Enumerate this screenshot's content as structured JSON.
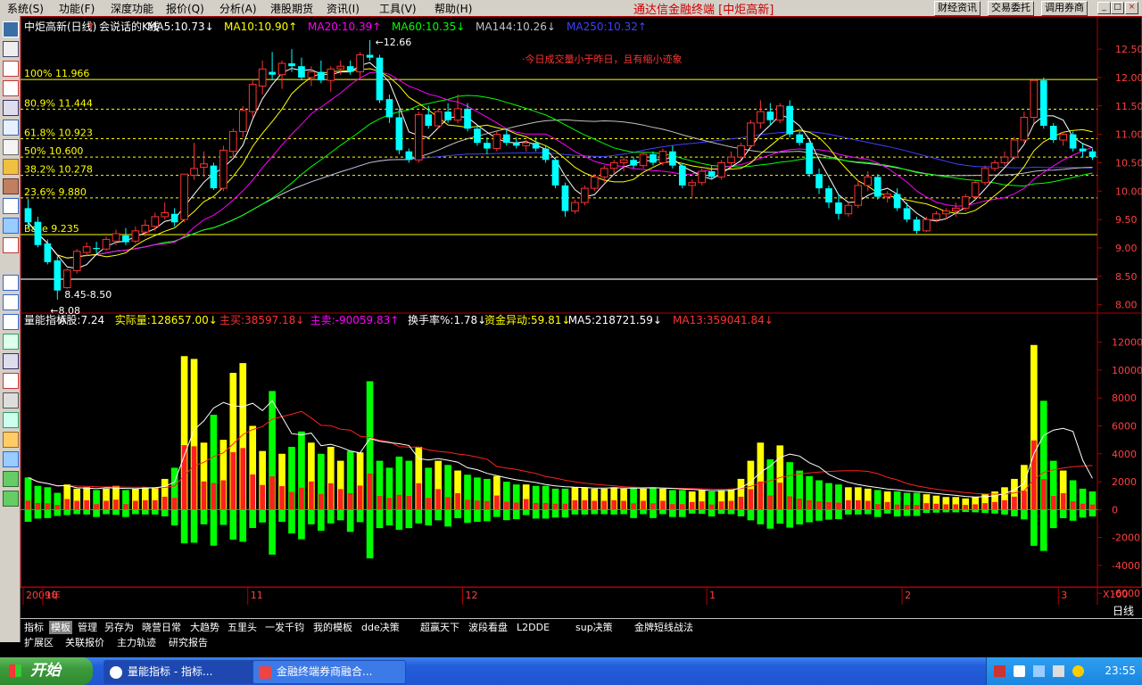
{
  "menu": [
    "系统(S)",
    "功能(F)",
    "深度功能",
    "报价(Q)",
    "分析(A)",
    "港股期货",
    "资讯(I)",
    "工具(V)",
    "帮助(H)"
  ],
  "app_title": "通达信金融终端 [中炬高新]",
  "top_buttons": [
    "财经资讯",
    "交易委托",
    "调用券商"
  ],
  "window_buttons": [
    "_",
    "□",
    "×"
  ],
  "colors": {
    "up": "#ff3232",
    "down": "#00ffff",
    "ma5": "#ffffff",
    "ma10": "#ffff00",
    "ma20": "#ff00ff",
    "ma60": "#00ff00",
    "ma144": "#c0c0c0",
    "ma250": "#4040ff",
    "bg": "#000000",
    "border": "#b00000"
  },
  "price_panel": {
    "header": [
      {
        "t": "中炬高新(日线)",
        "c": "#ffffff"
      },
      {
        "t": "↑",
        "c": "#ff3232"
      },
      {
        "t": "会说话的K线",
        "c": "#ffffff"
      },
      {
        "t": "MA5:10.73↓",
        "c": "#ffffff"
      },
      {
        "t": "MA10:10.90↑",
        "c": "#ffff00"
      },
      {
        "t": "MA20:10.39↑",
        "c": "#ff00ff"
      },
      {
        "t": "MA60:10.35↓",
        "c": "#00ff00"
      },
      {
        "t": "MA144:10.26↓",
        "c": "#c0c0c0"
      },
      {
        "t": "MA250:10.32↑",
        "c": "#4040ff"
      }
    ],
    "yticks": [
      12.5,
      12.0,
      11.5,
      11.0,
      10.5,
      10.0,
      9.5,
      9.0,
      8.5,
      8.0
    ],
    "fib_levels": [
      {
        "label": "100% 11.966",
        "value": 11.966,
        "solid": true
      },
      {
        "label": "80.9% 11.444",
        "value": 11.444,
        "solid": false
      },
      {
        "label": "61.8% 10.923",
        "value": 10.923,
        "solid": false
      },
      {
        "label": "50% 10.600",
        "value": 10.6,
        "solid": false
      },
      {
        "label": "38.2% 10.278",
        "value": 10.278,
        "solid": false
      },
      {
        "label": "23.6% 9.880",
        "value": 9.88,
        "solid": false
      },
      {
        "label": "Base 9.235",
        "value": 9.235,
        "solid": true
      }
    ],
    "high_label": "12.66",
    "low_label": "8.08",
    "range_label": "8.45-8.50",
    "gray_line": 8.45,
    "annotation": "今日成交量小于昨日，且有缩小迹象"
  },
  "volume_panel": {
    "header": [
      {
        "t": "量能指标",
        "c": "#ffffff"
      },
      {
        "t": "A股:7.24",
        "c": "#ffffff"
      },
      {
        "t": "实际量:128657.00↓",
        "c": "#ffff00"
      },
      {
        "t": "主买:38597.18↓",
        "c": "#ff3232"
      },
      {
        "t": "主卖:-90059.83↑",
        "c": "#ff00ff"
      },
      {
        "t": "换手率%:1.78↓",
        "c": "#ffffff"
      },
      {
        "t": "资金异动:59.81↓",
        "c": "#ffff00"
      },
      {
        "t": "MA5:218721.59↓",
        "c": "#ffffff"
      },
      {
        "t": "MA13:359041.84↓",
        "c": "#ff3232"
      }
    ],
    "yticks": [
      12000,
      10000,
      8000,
      6000,
      4000,
      2000,
      0,
      -2000,
      -4000,
      -6000
    ],
    "unit": "X100"
  },
  "x_axis": [
    {
      "label": "2009年",
      "i": 0
    },
    {
      "label": "10",
      "i": 2
    },
    {
      "label": "11",
      "i": 23
    },
    {
      "label": "12",
      "i": 45
    },
    {
      "label": "1",
      "i": 70
    },
    {
      "label": "2",
      "i": 90
    },
    {
      "label": "3",
      "i": 106
    }
  ],
  "period": "日线",
  "tabs1": [
    "指标",
    "模板",
    "管理",
    "另存为",
    "晓营日常",
    "大趋势",
    "五里头",
    "一发千钧",
    "我的模板",
    "dde决策",
    "超赢天下",
    "波段看盘",
    "L2DDE",
    "sup决策",
    "金牌短线战法"
  ],
  "tabs1_active": 1,
  "tabs2": [
    "扩展区",
    "关联报价",
    "主力轨迹",
    "研究报告"
  ],
  "taskbar": {
    "start": "开始",
    "items": [
      "量能指标 - 指标...",
      "金融终端券商融合..."
    ],
    "clock": "23:55"
  },
  "chart_data": {
    "type": "candlestick",
    "title": "中炬高新(日线)",
    "ohlc": [
      [
        9.7,
        9.86,
        9.36,
        9.45
      ],
      [
        9.46,
        9.55,
        9.01,
        9.05
      ],
      [
        9.08,
        9.15,
        8.71,
        8.75
      ],
      [
        8.78,
        8.85,
        8.09,
        8.25
      ],
      [
        8.3,
        8.64,
        8.28,
        8.61
      ],
      [
        8.6,
        8.98,
        8.55,
        8.94
      ],
      [
        8.92,
        9.1,
        8.85,
        9.02
      ],
      [
        9.0,
        9.11,
        8.9,
        8.98
      ],
      [
        8.98,
        9.2,
        8.95,
        9.15
      ],
      [
        9.12,
        9.32,
        9.05,
        9.25
      ],
      [
        9.22,
        9.35,
        9.05,
        9.1
      ],
      [
        9.12,
        9.38,
        9.08,
        9.3
      ],
      [
        9.28,
        9.5,
        9.2,
        9.4
      ],
      [
        9.38,
        9.62,
        9.3,
        9.55
      ],
      [
        9.55,
        9.8,
        9.5,
        9.62
      ],
      [
        9.6,
        9.7,
        9.38,
        9.45
      ],
      [
        9.5,
        10.3,
        9.45,
        10.3
      ],
      [
        10.28,
        10.85,
        10.2,
        10.4
      ],
      [
        10.42,
        10.7,
        10.25,
        10.48
      ],
      [
        10.45,
        10.5,
        10.02,
        10.05
      ],
      [
        10.05,
        10.8,
        10.0,
        10.72
      ],
      [
        10.7,
        11.1,
        10.6,
        11.05
      ],
      [
        11.05,
        11.5,
        10.95,
        11.42
      ],
      [
        11.4,
        11.95,
        11.3,
        11.88
      ],
      [
        11.85,
        12.3,
        11.7,
        12.15
      ],
      [
        12.1,
        12.45,
        11.95,
        12.05
      ],
      [
        12.05,
        12.3,
        11.8,
        12.25
      ],
      [
        12.25,
        12.5,
        12.1,
        12.2
      ],
      [
        12.2,
        12.35,
        11.95,
        12.0
      ],
      [
        12.0,
        12.2,
        11.85,
        12.1
      ],
      [
        12.1,
        12.3,
        11.9,
        11.95
      ],
      [
        11.95,
        12.2,
        11.75,
        12.15
      ],
      [
        12.15,
        12.3,
        12.05,
        12.2
      ],
      [
        12.2,
        12.3,
        12.05,
        12.1
      ],
      [
        12.1,
        12.45,
        12.0,
        12.4
      ],
      [
        12.4,
        12.66,
        12.3,
        12.35
      ],
      [
        12.35,
        12.4,
        11.55,
        11.6
      ],
      [
        11.62,
        11.7,
        11.2,
        11.3
      ],
      [
        11.3,
        11.45,
        10.65,
        10.72
      ],
      [
        10.7,
        10.75,
        10.5,
        10.55
      ],
      [
        10.55,
        11.4,
        10.5,
        11.35
      ],
      [
        11.35,
        11.5,
        11.1,
        11.15
      ],
      [
        11.15,
        11.45,
        11.1,
        11.4
      ],
      [
        11.4,
        11.55,
        11.2,
        11.25
      ],
      [
        11.25,
        11.7,
        11.2,
        11.45
      ],
      [
        11.45,
        11.55,
        11.05,
        11.1
      ],
      [
        11.1,
        11.15,
        10.8,
        10.85
      ],
      [
        10.85,
        10.95,
        10.65,
        10.75
      ],
      [
        10.75,
        11.05,
        10.7,
        11.0
      ],
      [
        11.0,
        11.1,
        10.8,
        10.85
      ],
      [
        10.85,
        10.95,
        10.75,
        10.8
      ],
      [
        10.8,
        10.9,
        10.7,
        10.85
      ],
      [
        10.85,
        10.95,
        10.7,
        10.75
      ],
      [
        10.75,
        10.8,
        10.5,
        10.55
      ],
      [
        10.55,
        10.6,
        10.05,
        10.1
      ],
      [
        10.1,
        10.15,
        9.55,
        9.65
      ],
      [
        9.65,
        9.85,
        9.6,
        9.8
      ],
      [
        9.8,
        10.1,
        9.75,
        10.05
      ],
      [
        10.05,
        10.3,
        10.0,
        10.25
      ],
      [
        10.25,
        10.45,
        10.15,
        10.4
      ],
      [
        10.4,
        10.55,
        10.3,
        10.5
      ],
      [
        10.5,
        10.6,
        10.35,
        10.55
      ],
      [
        10.55,
        10.6,
        10.4,
        10.45
      ],
      [
        10.45,
        10.7,
        10.4,
        10.65
      ],
      [
        10.65,
        10.7,
        10.45,
        10.5
      ],
      [
        10.5,
        10.75,
        10.45,
        10.7
      ],
      [
        10.7,
        10.8,
        10.4,
        10.45
      ],
      [
        10.45,
        10.5,
        10.05,
        10.1
      ],
      [
        10.1,
        10.2,
        9.9,
        10.15
      ],
      [
        10.15,
        10.4,
        10.1,
        10.35
      ],
      [
        10.35,
        10.45,
        10.2,
        10.25
      ],
      [
        10.25,
        10.55,
        10.2,
        10.5
      ],
      [
        10.5,
        10.7,
        10.4,
        10.6
      ],
      [
        10.6,
        10.85,
        10.55,
        10.8
      ],
      [
        10.8,
        11.25,
        10.75,
        11.2
      ],
      [
        11.2,
        11.6,
        11.1,
        11.4
      ],
      [
        11.4,
        11.55,
        11.15,
        11.25
      ],
      [
        11.25,
        11.55,
        11.2,
        11.5
      ],
      [
        11.5,
        11.6,
        10.95,
        11.0
      ],
      [
        11.0,
        11.05,
        10.8,
        10.85
      ],
      [
        10.85,
        10.9,
        10.25,
        10.3
      ],
      [
        10.3,
        10.4,
        9.95,
        10.05
      ],
      [
        10.05,
        10.1,
        9.7,
        9.8
      ],
      [
        9.8,
        9.95,
        9.5,
        9.6
      ],
      [
        9.6,
        9.8,
        9.55,
        9.75
      ],
      [
        9.75,
        10.2,
        9.7,
        10.1
      ],
      [
        10.1,
        10.35,
        10.0,
        10.25
      ],
      [
        10.25,
        10.3,
        9.85,
        9.9
      ],
      [
        9.9,
        10.0,
        9.8,
        9.95
      ],
      [
        9.95,
        10.05,
        9.65,
        9.7
      ],
      [
        9.7,
        9.8,
        9.45,
        9.5
      ],
      [
        9.5,
        9.55,
        9.25,
        9.3
      ],
      [
        9.3,
        9.55,
        9.28,
        9.5
      ],
      [
        9.5,
        9.65,
        9.45,
        9.6
      ],
      [
        9.6,
        9.7,
        9.5,
        9.65
      ],
      [
        9.65,
        9.8,
        9.55,
        9.7
      ],
      [
        9.7,
        9.95,
        9.65,
        9.9
      ],
      [
        9.9,
        10.2,
        9.85,
        10.15
      ],
      [
        10.15,
        10.45,
        10.1,
        10.4
      ],
      [
        10.4,
        10.55,
        10.35,
        10.5
      ],
      [
        10.5,
        10.7,
        10.45,
        10.6
      ],
      [
        10.6,
        10.95,
        10.55,
        10.9
      ],
      [
        10.9,
        11.4,
        10.85,
        11.3
      ],
      [
        11.3,
        11.97,
        11.2,
        11.95
      ],
      [
        11.95,
        12.0,
        11.1,
        11.15
      ],
      [
        11.15,
        11.2,
        10.85,
        10.9
      ],
      [
        10.9,
        11.05,
        10.8,
        11.0
      ],
      [
        11.0,
        11.05,
        10.7,
        10.75
      ],
      [
        10.75,
        10.85,
        10.6,
        10.7
      ],
      [
        10.7,
        10.75,
        10.55,
        10.6
      ]
    ],
    "volume": [
      2300,
      1700,
      1600,
      1200,
      1800,
      1500,
      1600,
      1400,
      1500,
      1700,
      1400,
      1500,
      1600,
      1600,
      2200,
      3000,
      11000,
      10800,
      4800,
      6800,
      5000,
      9800,
      10500,
      6000,
      4200,
      8500,
      4000,
      4500,
      5600,
      4800,
      4000,
      4500,
      3500,
      4200,
      4100,
      9200,
      3500,
      3000,
      3800,
      3500,
      4500,
      3000,
      3500,
      3200,
      2800,
      2500,
      2300,
      2200,
      2400,
      2000,
      1800,
      1800,
      1700,
      1700,
      1500,
      1500,
      1600,
      1600,
      1500,
      1500,
      1600,
      1500,
      1600,
      1500,
      1600,
      1500,
      1400,
      1400,
      1300,
      1400,
      1300,
      1400,
      1500,
      2200,
      3500,
      4800,
      3600,
      4600,
      3400,
      2800,
      2400,
      2100,
      1900,
      1800,
      1600,
      1600,
      1500,
      1400,
      1300,
      1300,
      1200,
      1200,
      1100,
      1000,
      900,
      900,
      800,
      900,
      1100,
      1300,
      1600,
      2200,
      3200,
      11800,
      7800,
      3500,
      2800,
      2100,
      1500,
      1300
    ]
  }
}
